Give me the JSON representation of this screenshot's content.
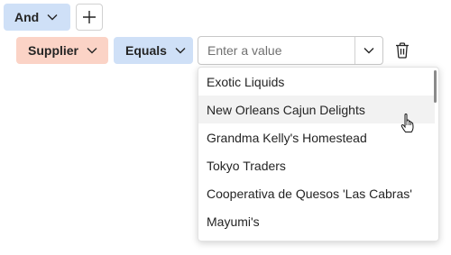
{
  "filter": {
    "logic_operator": "And",
    "field": "Supplier",
    "operator": "Equals",
    "value_placeholder": "Enter a value",
    "value": ""
  },
  "icons": {
    "add": "plus-icon",
    "delete": "trash-icon",
    "chevron": "chevron-down-icon"
  },
  "colors": {
    "logic_pill": "#cfe0f7",
    "field_pill": "#fbd3c6",
    "operator_pill": "#cfe0f7",
    "option_hover": "#f2f2f2"
  },
  "dropdown": {
    "options": [
      "Exotic Liquids",
      "New Orleans Cajun Delights",
      "Grandma Kelly's Homestead",
      "Tokyo Traders",
      "Cooperativa de Quesos 'Las Cabras'",
      "Mayumi's"
    ],
    "hovered_index": 1
  }
}
